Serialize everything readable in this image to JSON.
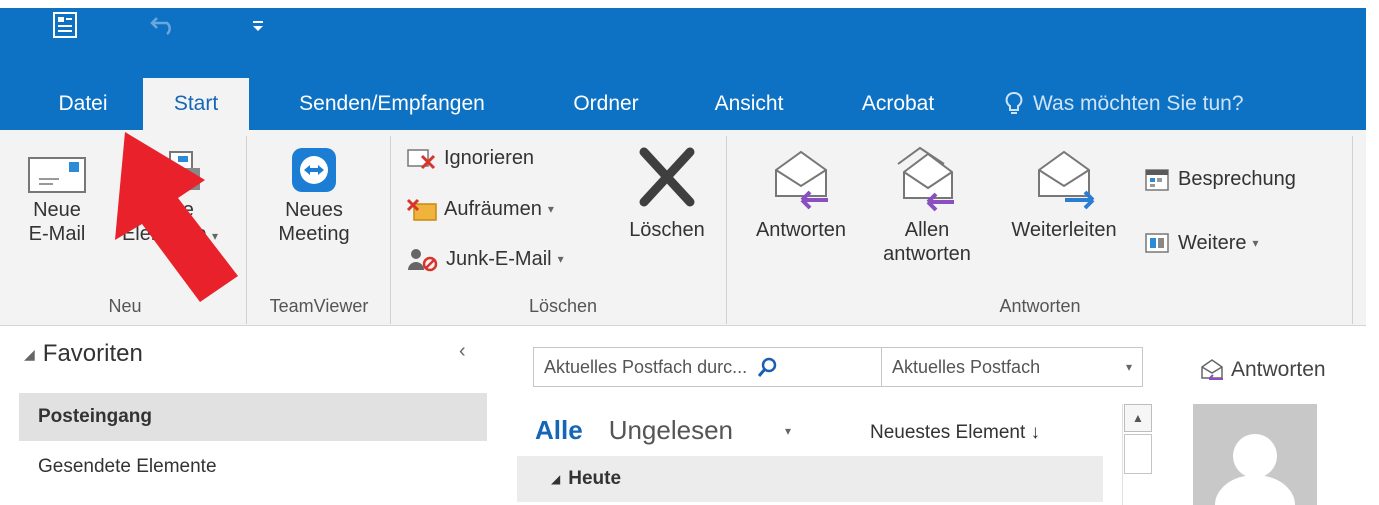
{
  "window": {
    "qat": [
      "outlook-icon",
      "undo-icon",
      "customize-qat-icon"
    ]
  },
  "tabs": [
    "Datei",
    "Start",
    "Senden/Empfangen",
    "Ordner",
    "Ansicht",
    "Acrobat"
  ],
  "tell_me": "Was möchten Sie tun?",
  "ribbon": {
    "neu": {
      "label": "Neu",
      "new_email": [
        "Neue",
        "E-Mail"
      ],
      "new_items": [
        "Neue",
        "Elemente"
      ]
    },
    "teamviewer": {
      "label": "TeamViewer",
      "meeting": [
        "Neues",
        "Meeting"
      ]
    },
    "loeschen": {
      "label": "Löschen",
      "ignore": "Ignorieren",
      "cleanup": "Aufräumen",
      "junk": "Junk-E-Mail",
      "delete": "Löschen"
    },
    "antworten": {
      "label": "Antworten",
      "reply": "Antworten",
      "reply_all": [
        "Allen",
        "antworten"
      ],
      "forward": "Weiterleiten",
      "meeting": "Besprechung",
      "more": "Weitere"
    }
  },
  "nav": {
    "favorites": "Favoriten",
    "folders": [
      "Posteingang",
      "Gesendete Elemente"
    ]
  },
  "search": {
    "placeholder": "Aktuelles Postfach durc...",
    "scope": "Aktuelles Postfach"
  },
  "filters": {
    "all": "Alle",
    "unread": "Ungelesen",
    "sort": "Neuestes Element ↓"
  },
  "group_today": "Heute",
  "reading": {
    "reply": "Antworten"
  },
  "colors": {
    "accent": "#0e72c4",
    "arrow": "#e8212b"
  }
}
